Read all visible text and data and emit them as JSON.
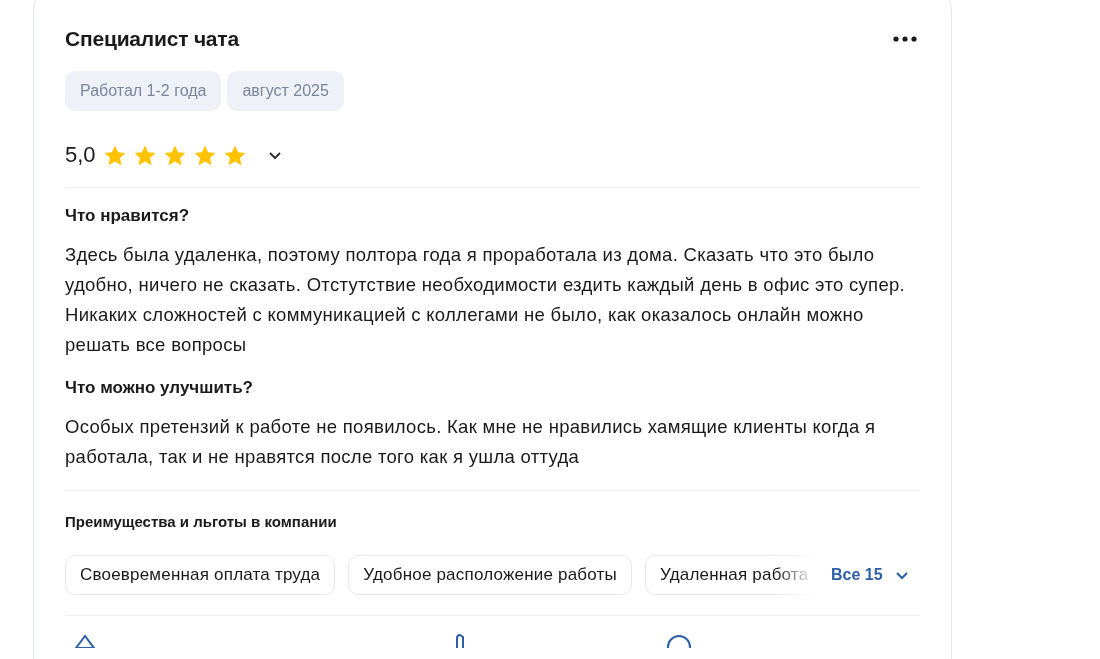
{
  "review": {
    "position": "Специалист чата",
    "tags": [
      "Работал 1-2 года",
      "август 2025"
    ],
    "rating": {
      "value": "5,0",
      "stars": 5,
      "expanded": false
    },
    "sections": [
      {
        "heading": "Что нравится?",
        "text": "Здесь была удаленка, поэтому полтора года я проработала из дома. Сказать что это было удобно, ничего не сказать. Отстутствие необходимости ездить каждый день в офис это супер. Никаких сложностей с коммуникацией с коллегами не было, как оказалось онлайн можно решать все вопросы"
      },
      {
        "heading": "Что можно улучшить?",
        "text": "Особых претензий к работе не появилось. Как мне не нравились хамящие клиенты когда я работала, так и не нравятся после того как я ушла оттуда"
      }
    ],
    "benefits": {
      "heading": "Преимущества и льготы в компании",
      "items": [
        "Своевременная оплата труда",
        "Удобное расположение работы",
        "Удаленная работа"
      ],
      "more": "Все 15"
    }
  }
}
